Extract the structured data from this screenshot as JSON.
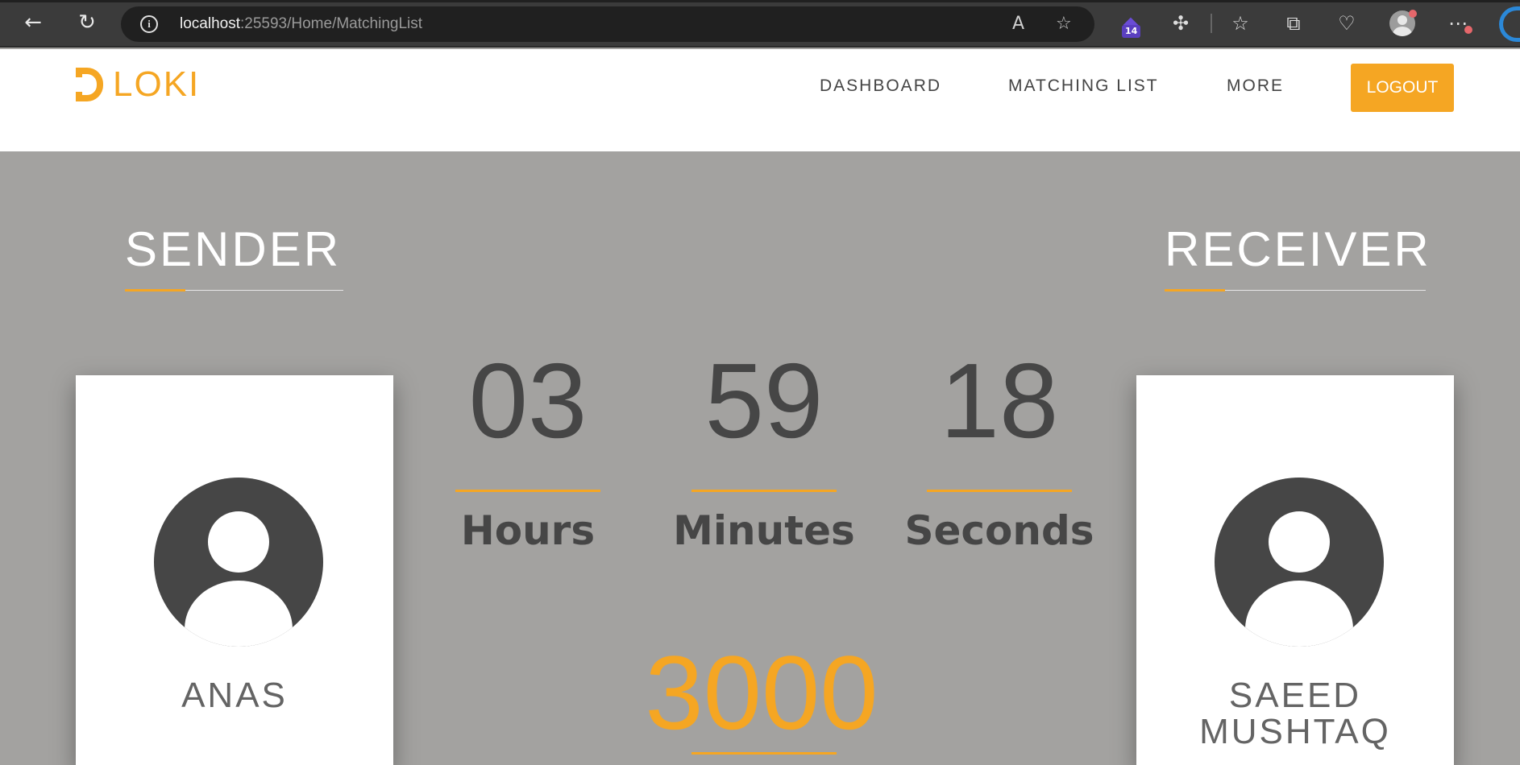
{
  "browser": {
    "url_host": "localhost",
    "url_path": ":25593/Home/MatchingList",
    "extension_badge": "14"
  },
  "site": {
    "logo_text": "LOKI",
    "nav": {
      "dashboard": "DASHBOARD",
      "matching_list": "MATCHING LIST",
      "more": "MORE",
      "logout": "LOGOUT"
    }
  },
  "sender": {
    "title": "SENDER",
    "name": "ANAS"
  },
  "receiver": {
    "title": "RECEIVER",
    "name_line1": "SAEED",
    "name_line2": "MUSHTAQ"
  },
  "countdown": {
    "hours": "03",
    "minutes": "59",
    "seconds": "18",
    "hours_label": "Hours",
    "minutes_label": "Minutes",
    "seconds_label": "Seconds"
  },
  "amount": "3000",
  "colors": {
    "accent": "#f5a623",
    "background": "#a3a2a0",
    "text_dark": "#464646"
  }
}
